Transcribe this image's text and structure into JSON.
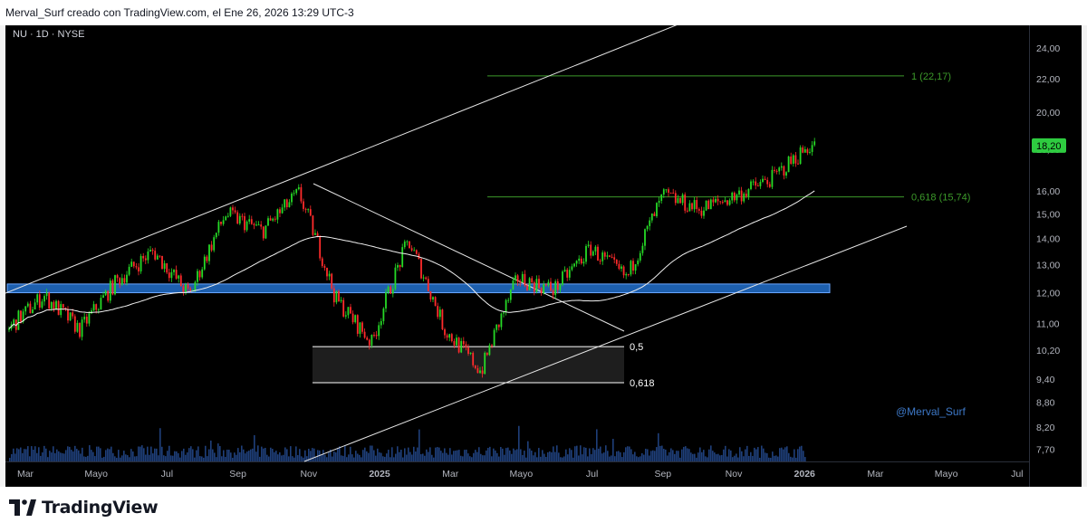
{
  "header": {
    "caption": "Merval_Surf creado con TradingView.com, el Ene 26, 2026 13:29 UTC-3"
  },
  "footer": {
    "brand": "TradingView",
    "logo_icon": "tradingview-logo-icon"
  },
  "colors": {
    "background": "#000000",
    "up": "#26d926",
    "down": "#ff2b2b",
    "fib": "#3c9a2a",
    "channel": "#e6e6e6",
    "zone": "#1d5fae",
    "volume": "#1f3f7a",
    "price_badge": "#2ecc40",
    "watermark": "#3d78c7"
  },
  "chart_data": {
    "type": "candlestick",
    "title": "",
    "symbol_label": "NU · 1D · NYSE",
    "watermark": "@Merval_Surf",
    "y_ticks": [
      "24,00",
      "22,00",
      "20,00",
      "18,00",
      "16,00",
      "15,00",
      "14,00",
      "13,00",
      "12,00",
      "11,00",
      "10,20",
      "9,40",
      "8,80",
      "8,20",
      "7,70"
    ],
    "x_ticks": [
      "Mar",
      "Mayo",
      "Jul",
      "Sep",
      "Nov",
      "2025",
      "Mar",
      "Mayo",
      "Jul",
      "Sep",
      "Nov",
      "2026",
      "Mar",
      "Mayo",
      "Jul"
    ],
    "bold_x_ticks": [
      "2025",
      "2026"
    ],
    "ylim": [
      7.5,
      25.0
    ],
    "y_scale": "log",
    "last_price": "18,20",
    "price_series": [
      {
        "month": "2024-03",
        "close": 10.8
      },
      {
        "month": "2024-04",
        "close": 11.9
      },
      {
        "month": "2024-05",
        "close": 10.8
      },
      {
        "month": "2024-06",
        "close": 12.4
      },
      {
        "month": "2024-07",
        "close": 13.5
      },
      {
        "month": "2024-08",
        "close": 11.9
      },
      {
        "month": "2024-09",
        "close": 15.0
      },
      {
        "month": "2024-10",
        "close": 14.3
      },
      {
        "month": "2024-11",
        "close": 15.9
      },
      {
        "month": "2024-12",
        "close": 11.8
      },
      {
        "month": "2025-01",
        "close": 10.4
      },
      {
        "month": "2025-02",
        "close": 13.9
      },
      {
        "month": "2025-03",
        "close": 10.8
      },
      {
        "month": "2025-04",
        "close": 9.6
      },
      {
        "month": "2025-05",
        "close": 12.5
      },
      {
        "month": "2025-06",
        "close": 12.1
      },
      {
        "month": "2025-07",
        "close": 13.6
      },
      {
        "month": "2025-08",
        "close": 12.5
      },
      {
        "month": "2025-09",
        "close": 15.8
      },
      {
        "month": "2025-10",
        "close": 15.2
      },
      {
        "month": "2025-11",
        "close": 15.8
      },
      {
        "month": "2025-12",
        "close": 16.6
      },
      {
        "month": "2026-01",
        "close": 18.2
      }
    ],
    "fib_levels": [
      {
        "label": "1 (22,17)",
        "price": 22.17
      },
      {
        "label": "0,618 (15,74)",
        "price": 15.74
      }
    ],
    "box_levels": [
      {
        "label": "0,5",
        "price": 10.3
      },
      {
        "label": "0,618",
        "price": 9.3
      }
    ],
    "support_zone": [
      12.0,
      12.3
    ],
    "moving_average_line": "white",
    "grid": false
  }
}
